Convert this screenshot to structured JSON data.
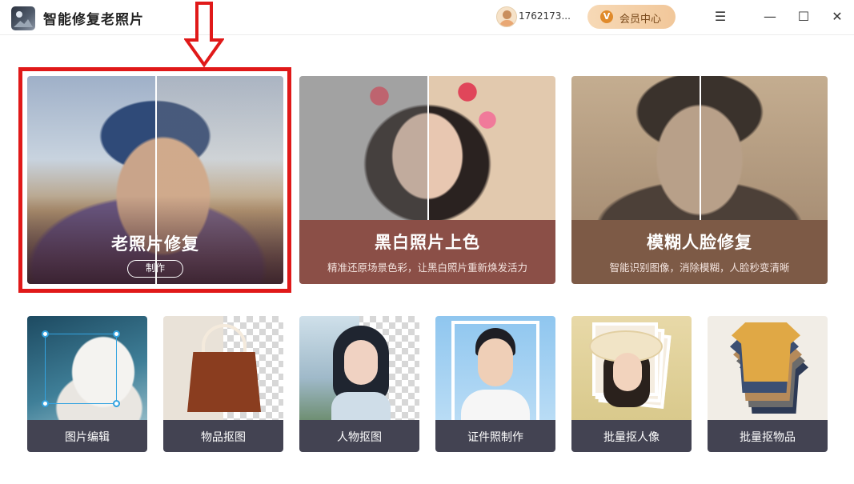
{
  "app": {
    "title": "智能修复老照片"
  },
  "user": {
    "id": "1762173..."
  },
  "vip": {
    "label": "会员中心",
    "icon_letter": "V"
  },
  "window_controls": {
    "menu": "☰",
    "minimize": "—",
    "maximize": "☐",
    "close": "✕"
  },
  "feature_cards": [
    {
      "title": "老照片修复",
      "button": "制作",
      "selected": true
    },
    {
      "title": "黑白照片上色",
      "subtitle": "精准还原场景色彩，让黑白照片重新焕发活力"
    },
    {
      "title": "模糊人脸修复",
      "subtitle": "智能识别图像，消除模糊，人脸秒变清晰"
    }
  ],
  "tools": [
    {
      "label": "图片编辑"
    },
    {
      "label": "物品抠图"
    },
    {
      "label": "人物抠图"
    },
    {
      "label": "证件照制作"
    },
    {
      "label": "批量抠人像"
    },
    {
      "label": "批量抠物品"
    }
  ],
  "colors": {
    "highlight": "#e01919",
    "caption_brown": "#8b4f47",
    "tool_bar": "#434352",
    "vip_gold": "#f1c79a"
  },
  "icons": {
    "app_logo": "photo-landscape-icon",
    "avatar": "user-avatar-icon",
    "vip": "vip-crown-icon",
    "arrow": "down-arrow-icon"
  }
}
